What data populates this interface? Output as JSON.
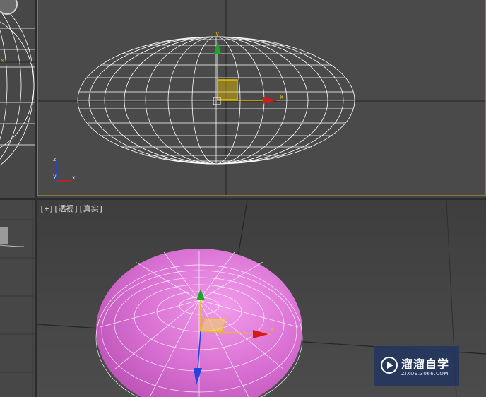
{
  "viewports": {
    "front": {
      "axis_labels": {
        "x": "x",
        "y": "y"
      },
      "corner_axis_labels": {
        "y": "y",
        "z": "z",
        "x": "x"
      }
    },
    "perspective": {
      "label_parts": [
        "[+]",
        "[透视]",
        "[真实]"
      ],
      "axis_labels": {
        "x": "x"
      }
    },
    "left": {
      "axis_labels": {
        "x": "x"
      }
    }
  },
  "colors": {
    "active_border": "#8d7a3a",
    "wireframe": "#ffffff",
    "object_fill": "#d86fd2",
    "axis_x": "#d21a1a",
    "axis_y": "#1fa32b",
    "axis_z": "#2244dd",
    "gizmo_plane": "#e6c200"
  },
  "watermark": {
    "name": "溜溜自学",
    "url": "ZIXUE.3066.COM",
    "icon": "play-icon"
  }
}
